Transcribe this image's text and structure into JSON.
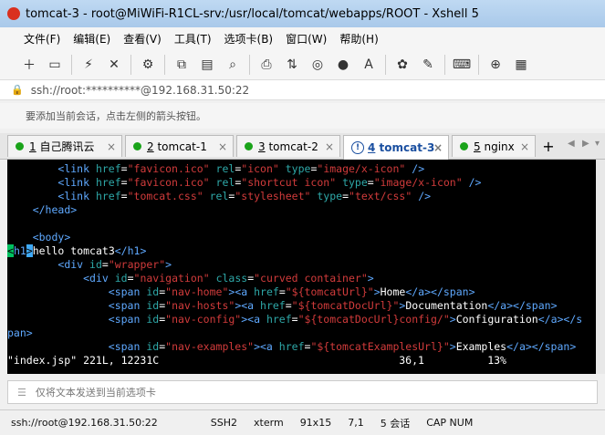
{
  "window": {
    "title": "tomcat-3 - root@MiWiFi-R1CL-srv:/usr/local/tomcat/webapps/ROOT - Xshell 5"
  },
  "menu": [
    "文件(F)",
    "编辑(E)",
    "查看(V)",
    "工具(T)",
    "选项卡(B)",
    "窗口(W)",
    "帮助(H)"
  ],
  "address": "ssh://root:**********@192.168.31.50:22",
  "hint": "要添加当前会话，点击左侧的箭头按钮。",
  "tabs": [
    {
      "num": "1",
      "label": "自己腾讯云"
    },
    {
      "num": "2",
      "label": "tomcat-1"
    },
    {
      "num": "3",
      "label": "tomcat-2"
    },
    {
      "num": "4",
      "label": "tomcat-3"
    },
    {
      "num": "5",
      "label": "nginx"
    }
  ],
  "terminal": {
    "lines": [
      "        <link href=\"favicon.ico\" rel=\"icon\" type=\"image/x-icon\" />",
      "        <link href=\"favicon.ico\" rel=\"shortcut icon\" type=\"image/x-icon\" />",
      "        <link href=\"tomcat.css\" rel=\"stylesheet\" type=\"text/css\" />",
      "    </head>",
      "",
      "    <body>",
      "<h1>hello tomcat3</h1>",
      "        <div id=\"wrapper\">",
      "            <div id=\"navigation\" class=\"curved container\">",
      "                <span id=\"nav-home\"><a href=\"${tomcatUrl}\">Home</a></span>",
      "                <span id=\"nav-hosts\"><a href=\"${tomcatDocUrl}\">Documentation</a></span>",
      "                <span id=\"nav-config\"><a href=\"${tomcatDocUrl}config/\">Configuration</a></s",
      "pan>",
      "                <span id=\"nav-examples\"><a href=\"${tomcatExamplesUrl}\">Examples</a></span>"
    ],
    "status": "\"index.jsp\" 221L, 12231C                                      36,1          13%"
  },
  "sendbar": "仅将文本发送到当前选项卡",
  "statusbar": {
    "conn": "ssh://root@192.168.31.50:22",
    "proto": "SSH2",
    "term": "xterm",
    "size": "91x15",
    "pos": "7,1",
    "sessions": "5 会话",
    "caps": "CAP NUM"
  }
}
